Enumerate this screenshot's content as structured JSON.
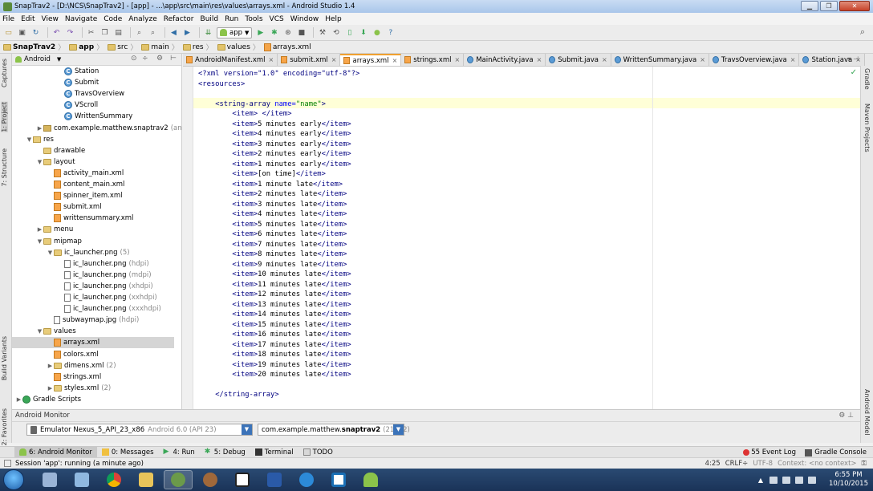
{
  "window": {
    "title": "SnapTrav2 - [D:\\NCS\\SnapTrav2] - [app] - ...\\app\\src\\main\\res\\values\\arrays.xml - Android Studio 1.4"
  },
  "menu": [
    "File",
    "Edit",
    "View",
    "Navigate",
    "Code",
    "Analyze",
    "Refactor",
    "Build",
    "Run",
    "Tools",
    "VCS",
    "Window",
    "Help"
  ],
  "toolbar": {
    "run_config": "app"
  },
  "breadcrumb": [
    "SnapTrav2",
    "app",
    "src",
    "main",
    "res",
    "values",
    "arrays.xml"
  ],
  "project_panel": {
    "view_mode": "Android",
    "tree": [
      {
        "label": "Station",
        "kind": "cls",
        "indent": 4,
        "twisty": ""
      },
      {
        "label": "Submit",
        "kind": "cls",
        "indent": 4,
        "twisty": ""
      },
      {
        "label": "TravsOverview",
        "kind": "cls",
        "indent": 4,
        "twisty": ""
      },
      {
        "label": "VScroll",
        "kind": "cls",
        "indent": 4,
        "twisty": ""
      },
      {
        "label": "WrittenSummary",
        "kind": "cls",
        "indent": 4,
        "twisty": ""
      },
      {
        "label": "com.example.matthew.snaptrav2",
        "dim": "(andr",
        "kind": "pkg",
        "indent": 2,
        "twisty": "▶"
      },
      {
        "label": "res",
        "kind": "res",
        "indent": 1,
        "twisty": "▼"
      },
      {
        "label": "drawable",
        "kind": "folder",
        "indent": 2,
        "twisty": ""
      },
      {
        "label": "layout",
        "kind": "folder",
        "indent": 2,
        "twisty": "▼"
      },
      {
        "label": "activity_main.xml",
        "kind": "xml",
        "indent": 3,
        "twisty": ""
      },
      {
        "label": "content_main.xml",
        "kind": "xml",
        "indent": 3,
        "twisty": ""
      },
      {
        "label": "spinner_item.xml",
        "kind": "xml",
        "indent": 3,
        "twisty": ""
      },
      {
        "label": "submit.xml",
        "kind": "xml",
        "indent": 3,
        "twisty": ""
      },
      {
        "label": "writtensummary.xml",
        "kind": "xml",
        "indent": 3,
        "twisty": ""
      },
      {
        "label": "menu",
        "kind": "folder",
        "indent": 2,
        "twisty": "▶"
      },
      {
        "label": "mipmap",
        "kind": "folder",
        "indent": 2,
        "twisty": "▼"
      },
      {
        "label": "ic_launcher.png",
        "dim": "(5)",
        "kind": "folder",
        "indent": 3,
        "twisty": "▼"
      },
      {
        "label": "ic_launcher.png",
        "dim": "(hdpi)",
        "kind": "png",
        "indent": 4,
        "twisty": ""
      },
      {
        "label": "ic_launcher.png",
        "dim": "(mdpi)",
        "kind": "png",
        "indent": 4,
        "twisty": ""
      },
      {
        "label": "ic_launcher.png",
        "dim": "(xhdpi)",
        "kind": "png",
        "indent": 4,
        "twisty": ""
      },
      {
        "label": "ic_launcher.png",
        "dim": "(xxhdpi)",
        "kind": "png",
        "indent": 4,
        "twisty": ""
      },
      {
        "label": "ic_launcher.png",
        "dim": "(xxxhdpi)",
        "kind": "png",
        "indent": 4,
        "twisty": ""
      },
      {
        "label": "subwaymap.jpg",
        "dim": "(hdpi)",
        "kind": "png",
        "indent": 3,
        "twisty": ""
      },
      {
        "label": "values",
        "kind": "folder",
        "indent": 2,
        "twisty": "▼"
      },
      {
        "label": "arrays.xml",
        "kind": "xml",
        "indent": 3,
        "twisty": "",
        "selected": true
      },
      {
        "label": "colors.xml",
        "kind": "xml",
        "indent": 3,
        "twisty": ""
      },
      {
        "label": "dimens.xml",
        "dim": "(2)",
        "kind": "folder",
        "indent": 3,
        "twisty": "▶"
      },
      {
        "label": "strings.xml",
        "kind": "xml",
        "indent": 3,
        "twisty": ""
      },
      {
        "label": "styles.xml",
        "dim": "(2)",
        "kind": "folder",
        "indent": 3,
        "twisty": "▶"
      },
      {
        "label": "Gradle Scripts",
        "kind": "gradle",
        "indent": 0,
        "twisty": "▶"
      }
    ]
  },
  "left_strip": [
    "1: Project",
    "7: Structure",
    "Captures",
    "Build Variants",
    "2: Favorites"
  ],
  "right_strip": [
    "Gradle",
    "Maven Projects",
    "Android Model"
  ],
  "tabs": [
    {
      "label": "AndroidManifest.xml",
      "type": "x"
    },
    {
      "label": "submit.xml",
      "type": "x"
    },
    {
      "label": "arrays.xml",
      "type": "x",
      "active": true
    },
    {
      "label": "strings.xml",
      "type": "x"
    },
    {
      "label": "MainActivity.java",
      "type": "c"
    },
    {
      "label": "Submit.java",
      "type": "c"
    },
    {
      "label": "WrittenSummary.java",
      "type": "c"
    },
    {
      "label": "TravsOverview.java",
      "type": "c"
    },
    {
      "label": "Station.java",
      "type": "c"
    }
  ],
  "code": {
    "decl": "<?xml version=\"1.0\" encoding=\"utf-8\"?>",
    "resources_open": "<resources>",
    "array_name": "name",
    "items": [
      " ",
      "5 minutes early",
      "4 minutes early",
      "3 minutes early",
      "2 minutes early",
      "1 minutes early",
      "[on time]",
      "1 minute late",
      "2 minutes late",
      "3 minutes late",
      "4 minutes late",
      "5 minutes late",
      "6 minutes late",
      "7 minutes late",
      "8 minutes late",
      "9 minutes late",
      "10 minutes late",
      "11 minutes late",
      "12 minutes late",
      "13 minutes late",
      "14 minutes late",
      "15 minutes late",
      "16 minutes late",
      "17 minutes late",
      "18 minutes late",
      "19 minutes late",
      "20 minutes late"
    ],
    "array_close": "</string-array>"
  },
  "monitor": {
    "title": "Android Monitor",
    "device": "Emulator Nexus_5_API_23_x86",
    "device_dim": "Android 6.0 (API 23)",
    "process": "com.example.matthew.",
    "process_bold": "snaptrav2",
    "process_dim": "(21622)"
  },
  "tool_tabs": [
    "6: Android Monitor",
    "0: Messages",
    "4: Run",
    "5: Debug",
    "Terminal",
    "TODO"
  ],
  "event_log": "55 Event Log",
  "gradle_console": "Gradle Console",
  "status": {
    "message": "Session 'app': running (a minute ago)",
    "position": "4:25",
    "line_sep": "CRLF÷",
    "encoding": "UTF-8",
    "context": "Context: <no context>"
  },
  "clock": {
    "time": "6:55 PM",
    "date": "10/10/2015"
  }
}
